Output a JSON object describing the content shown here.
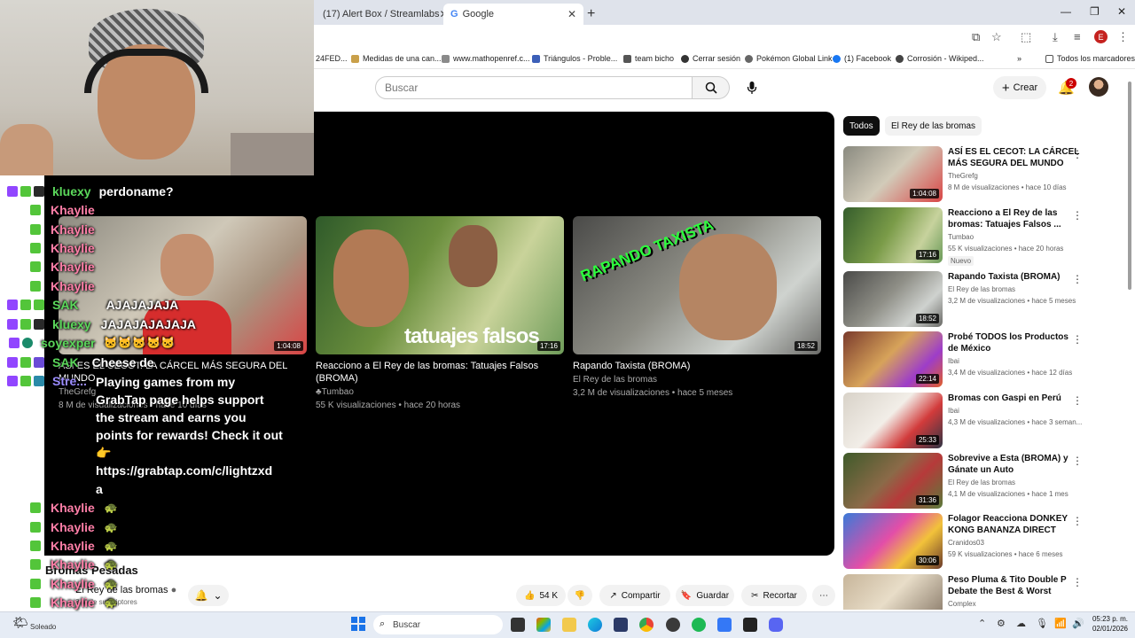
{
  "browser": {
    "tabs": [
      {
        "label": "(17) Alert Box / Streamlabs"
      },
      {
        "label": "Google"
      }
    ],
    "bookmarks": [
      "24FED...",
      "Medidas de una can...",
      "www.mathopenref.c...",
      "Triángulos - Proble...",
      "team bicho",
      "Cerrar sesión",
      "Pokémon Global Link",
      "(1) Facebook",
      "Corrosión - Wikiped...",
      "Todos los marcadores"
    ],
    "profile_initial": "E"
  },
  "youtube": {
    "search_placeholder": "Buscar",
    "create_label": "Crear",
    "notif_count": "2",
    "chips": [
      "Todos",
      "El Rey de las bromas"
    ],
    "endscreen": [
      {
        "title": "ASÍ ES EL CECOT: LA CÁRCEL MÁS SEGURA DEL MUNDO",
        "channel": "TheGrefg",
        "meta": "8 M de visualizaciones • hace 10 días",
        "duration": "1:04:08"
      },
      {
        "title": "Reacciono a El Rey de las bromas: Tatuajes Falsos (BROMA)",
        "channel": "Tumbao",
        "meta": "55 K visualizaciones • hace 20 horas",
        "duration": "17:16",
        "overlay": "tatuajes falsos"
      },
      {
        "title": "Rapando Taxista (BROMA)",
        "channel": "El Rey de las bromas",
        "meta": "3,2 M de visualizaciones • hace 5 meses",
        "duration": "18:52",
        "overlay": "RAPANDO TAXISTA"
      }
    ],
    "video_title": "Bromas Pesadas",
    "channel_name": "El Rey de las bromas",
    "subscribers": "3 M de suscriptores",
    "likes": "54 K",
    "actions": [
      "Compartir",
      "Guardar",
      "Recortar"
    ],
    "recommendations": [
      {
        "title": "ASÍ ES EL CECOT: LA CÁRCEL MÁS SEGURA DEL MUNDO",
        "channel": "TheGrefg",
        "views": "8 M de visualizaciones • hace 10 días",
        "duration": "1:04:08"
      },
      {
        "title": "Reacciono a El Rey de las bromas: Tatuajes Falsos ...",
        "channel": "Tumbao",
        "views": "55 K visualizaciones • hace 20 horas",
        "duration": "17:16",
        "badge": "Nuevo"
      },
      {
        "title": "Rapando Taxista (BROMA)",
        "channel": "El Rey de las bromas",
        "views": "3,2 M de visualizaciones • hace 5 meses",
        "duration": "18:52"
      },
      {
        "title": "Probé TODOS los Productos de México",
        "channel": "Ibai",
        "views": "3,4 M de visualizaciones • hace 12 días",
        "duration": "22:14"
      },
      {
        "title": "Bromas con Gaspi en Perú",
        "channel": "Ibai",
        "views": "4,3 M de visualizaciones • hace 3 seman...",
        "duration": "25:33"
      },
      {
        "title": "Sobrevive a Esta (BROMA) y Gánate un Auto",
        "channel": "El Rey de las bromas",
        "views": "4,1 M de visualizaciones • hace 1 mes",
        "duration": "31:36"
      },
      {
        "title": "Folagor Reacciona DONKEY KONG BANANZA DIRECT",
        "channel": "Cranidos03",
        "views": "59 K visualizaciones • hace 6 meses",
        "duration": "30:06"
      },
      {
        "title": "Peso Pluma & Tito Double P Debate the Best & Worst Thing...",
        "channel": "Complex",
        "views": "",
        "duration": ""
      }
    ]
  },
  "chat": {
    "lines": [
      {
        "user": "kluexy",
        "msg": "perdoname?",
        "color": "#5bd85b"
      },
      {
        "user": "Khaylie",
        "msg": "",
        "color": "#ff7fa8"
      },
      {
        "user": "Khaylie",
        "msg": "",
        "color": "#ff7fa8"
      },
      {
        "user": "Khaylie",
        "msg": "",
        "color": "#ff7fa8"
      },
      {
        "user": "Khaylie",
        "msg": "",
        "color": "#ff7fa8"
      },
      {
        "user": "Khaylie",
        "msg": "",
        "color": "#ff7fa8"
      },
      {
        "user": "SAK",
        "msg": "AJAJAJAJA",
        "color": "#5bd85b"
      },
      {
        "user": "kluexy",
        "msg": "JAJAJAJAJAJA",
        "color": "#5bd85b"
      },
      {
        "user": "soyexper",
        "msg": "",
        "color": "#5bd85b"
      },
      {
        "user": "SAK",
        "msg": "Cheese de",
        "color": "#5bd85b"
      },
      {
        "user": "Stre...",
        "msg": "",
        "color": "#9b8cff"
      }
    ],
    "bot_message": [
      "Playing games from my",
      "GrabTap page helps support",
      "the stream and earns you",
      "points for rewards! Check it out",
      "👉",
      "https://grabtap.com/c/lightzxd",
      "a"
    ],
    "tail_user": "Khaylie"
  },
  "taskbar": {
    "search_placeholder": "Buscar",
    "time": "05:23 p. m.",
    "date": "02/01/2026",
    "weather": "Soleado"
  }
}
